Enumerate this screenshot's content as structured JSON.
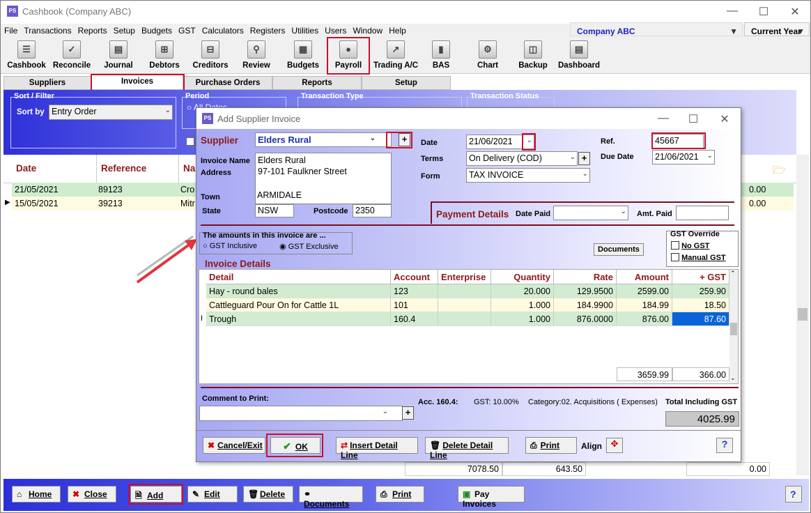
{
  "app": {
    "title": "Cashbook (Company ABC)",
    "company": "Company ABC",
    "period": "Current Year"
  },
  "menu": [
    "File",
    "Transactions",
    "Reports",
    "Setup",
    "Budgets",
    "GST",
    "Calculators",
    "Registers",
    "Utilities",
    "Users",
    "Window",
    "Help"
  ],
  "toolbar": [
    {
      "label": "Cashbook",
      "icon": "cashbook-icon"
    },
    {
      "label": "Reconcile",
      "icon": "reconcile-icon"
    },
    {
      "label": "Journal",
      "icon": "journal-icon"
    },
    {
      "label": "Debtors",
      "icon": "debtors-icon"
    },
    {
      "label": "Creditors",
      "icon": "creditors-icon"
    },
    {
      "label": "Review",
      "icon": "review-icon"
    },
    {
      "label": "Budgets",
      "icon": "budgets-icon"
    },
    {
      "label": "Payroll",
      "icon": "payroll-icon"
    },
    {
      "label": "Trading A/C",
      "icon": "trading-icon"
    },
    {
      "label": "BAS",
      "icon": "bas-icon"
    },
    {
      "label": "Chart",
      "icon": "chart-icon"
    },
    {
      "label": "Backup",
      "icon": "backup-icon"
    },
    {
      "label": "Dashboard",
      "icon": "dashboard-icon"
    }
  ],
  "tabs": [
    "Suppliers",
    "Invoices",
    "Purchase Orders",
    "Reports",
    "Setup"
  ],
  "filter": {
    "sort_legend": "Sort / Filter",
    "sort_by_label": "Sort by",
    "sort_by_value": "Entry Order",
    "period_legend": "Period",
    "period_option": "All Dates",
    "type_legend": "Transaction Type",
    "status_legend": "Transaction Status"
  },
  "grid": {
    "headers": [
      "Date",
      "Reference",
      "Nar"
    ],
    "rows": [
      {
        "date": "21/05/2021",
        "ref": "89123",
        "name": "Cro",
        "amount": "0.00"
      },
      {
        "date": "15/05/2021",
        "ref": "39213",
        "name": "Mitr",
        "amount": "0.00"
      }
    ],
    "totals": {
      "a": "7078.50",
      "b": "643.50",
      "c": "0.00"
    }
  },
  "bottom_buttons": [
    "Home",
    "Close",
    "Add",
    "Edit",
    "Delete",
    "Documents",
    "Print",
    "Pay Invoices"
  ],
  "dialog": {
    "title": "Add Supplier Invoice",
    "supplier_label": "Supplier",
    "supplier": "Elders Rural",
    "invoice_name_label": "Invoice Name",
    "address_label": "Address",
    "invoice_name": "Elders Rural",
    "address": "97-101 Faulkner Street",
    "town_label": "Town",
    "town": "ARMIDALE",
    "state_label": "State",
    "state": "NSW",
    "postcode_label": "Postcode",
    "postcode": "2350",
    "date_label": "Date",
    "date": "21/06/2021",
    "terms_label": "Terms",
    "terms": "On Delivery (COD)",
    "form_label": "Form",
    "form": "TAX INVOICE",
    "ref_label": "Ref.",
    "ref": "45667",
    "due_label": "Due Date",
    "due_date": "21/06/2021",
    "payment_details_label": "Payment Details",
    "date_paid_label": "Date Paid",
    "amt_paid_label": "Amt. Paid",
    "amounts_legend": "The amounts in this invoice are ...",
    "gst_inclusive": "GST Inclusive",
    "gst_exclusive": "GST Exclusive",
    "documents_button": "Documents",
    "gst_override_legend": "GST Override",
    "no_gst": "No GST",
    "manual_gst": "Manual GST",
    "invoice_details_label": "Invoice Details",
    "columns": [
      "Detail",
      "Account",
      "Enterprise",
      "Quantity",
      "Rate",
      "Amount",
      "+ GST"
    ],
    "lines": [
      {
        "detail": "Hay - round bales",
        "account": "123",
        "enterprise": "",
        "quantity": "20.000",
        "rate": "129.9500",
        "amount": "2599.00",
        "gst": "259.90"
      },
      {
        "detail": "Cattleguard Pour On for Cattle 1L",
        "account": "101",
        "enterprise": "",
        "quantity": "1.000",
        "rate": "184.9900",
        "amount": "184.99",
        "gst": "18.50"
      },
      {
        "detail": "Trough",
        "account": "160.4",
        "enterprise": "",
        "quantity": "1.000",
        "rate": "876.0000",
        "amount": "876.00",
        "gst": "87.60"
      }
    ],
    "total_amount": "3659.99",
    "total_gst": "366.00",
    "comment_label": "Comment to Print:",
    "acc_info": "Acc. 160.4:",
    "gst_info": "GST: 10.00%",
    "category_info": "Category:02. Acquisitions ( Expenses)",
    "total_incl_label": "Total Including GST",
    "total_incl": "4025.99",
    "buttons": {
      "cancel": "Cancel/Exit",
      "ok": "OK",
      "insert": "Insert Detail Line",
      "delete": "Delete Detail Line",
      "print": "Print",
      "align": "Align"
    }
  }
}
